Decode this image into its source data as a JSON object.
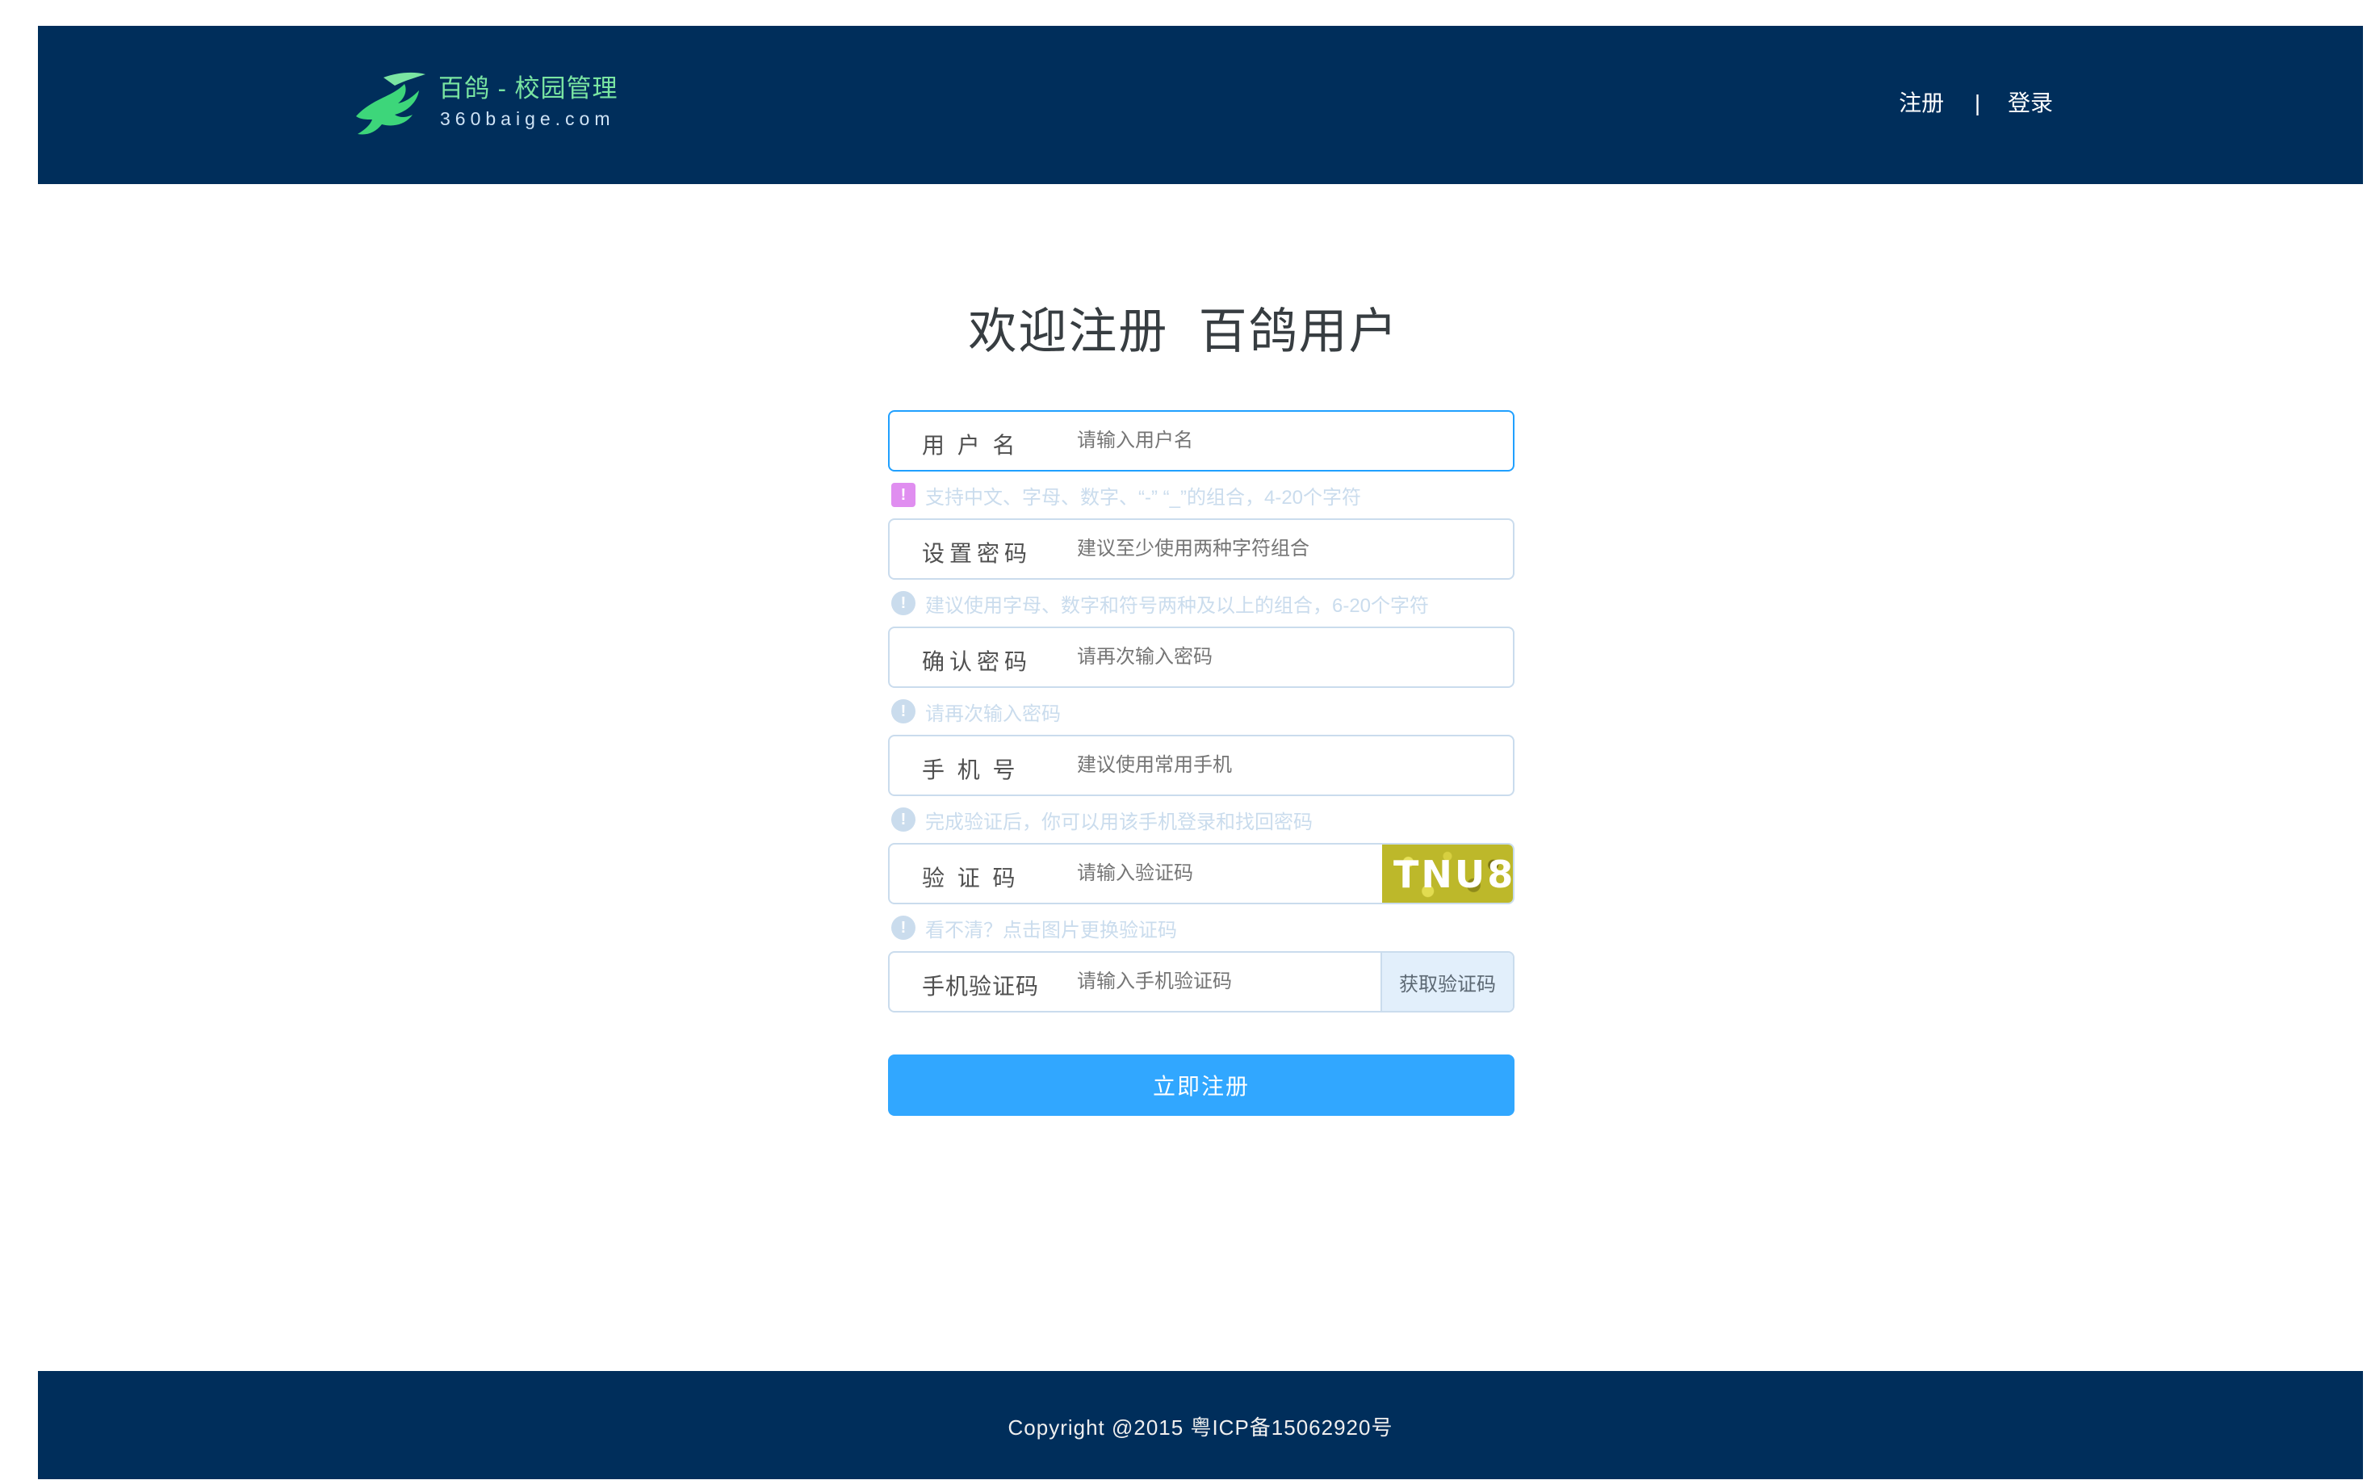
{
  "header": {
    "logo_title": "百鸽 - 校园管理",
    "logo_subtitle": "360baige.com",
    "nav": {
      "register": "注册",
      "divider": "|",
      "login": "登录"
    }
  },
  "title": "欢迎注册  百鸽用户",
  "form": {
    "username": {
      "label": "用 户 名",
      "placeholder": "请输入用户名",
      "hint": "支持中文、字母、数字、“-” “_”的组合，4-20个字符"
    },
    "password": {
      "label": "设置密码",
      "placeholder": "建议至少使用两种字符组合",
      "hint": "建议使用字母、数字和符号两种及以上的组合，6-20个字符"
    },
    "confirm_password": {
      "label": "确认密码",
      "placeholder": "请再次输入密码",
      "hint": "请再次输入密码"
    },
    "phone": {
      "label": "手 机 号",
      "placeholder": "建议使用常用手机",
      "hint": "完成验证后，你可以用该手机登录和找回密码"
    },
    "captcha": {
      "label": "验 证 码",
      "placeholder": "请输入验证码",
      "image_text": "TNU8",
      "hint": "看不清？点击图片更换验证码"
    },
    "sms_code": {
      "label": "手机验证码",
      "placeholder": "请输入手机验证码",
      "button": "获取验证码"
    },
    "submit": "立即注册"
  },
  "footer": {
    "copyright": "Copyright @2015 粤ICP备15062920号"
  },
  "colors": {
    "header_bg": "#002e5b",
    "title": "#373d41",
    "label": "#505050",
    "placeholder": "#cadced",
    "active_border": "#20a0ff",
    "sms_button_bg": "#e2effb",
    "sms_button_text": "#5c6873",
    "submit_bg": "#31a7ff",
    "footer_text": "#efefef"
  }
}
